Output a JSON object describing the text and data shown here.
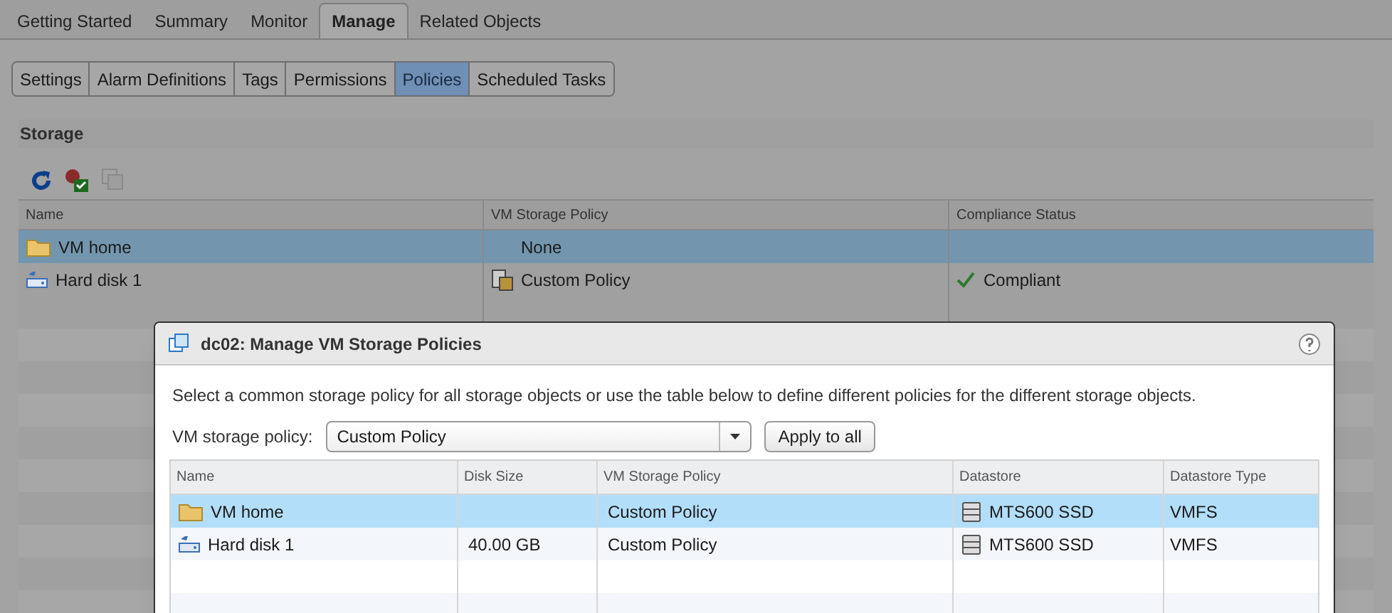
{
  "main_tabs": [
    {
      "label": "Getting Started",
      "selected": false
    },
    {
      "label": "Summary",
      "selected": false
    },
    {
      "label": "Monitor",
      "selected": false
    },
    {
      "label": "Manage",
      "selected": true
    },
    {
      "label": "Related Objects",
      "selected": false
    }
  ],
  "sub_tabs": [
    {
      "label": "Settings",
      "selected": false
    },
    {
      "label": "Alarm Definitions",
      "selected": false
    },
    {
      "label": "Tags",
      "selected": false
    },
    {
      "label": "Permissions",
      "selected": false
    },
    {
      "label": "Policies",
      "selected": true
    },
    {
      "label": "Scheduled Tasks",
      "selected": false
    }
  ],
  "section_title": "Storage",
  "toolbar": [
    {
      "kind": "refresh",
      "disabled": false
    },
    {
      "kind": "check-compliance",
      "disabled": false
    },
    {
      "kind": "reapply",
      "disabled": true
    }
  ],
  "storage_table": {
    "columns": [
      "Name",
      "VM Storage Policy",
      "Compliance Status"
    ],
    "rows": [
      {
        "kind": "folder",
        "name": "VM home",
        "policy": "None",
        "policy_icon": false,
        "compliance": "",
        "selected": true
      },
      {
        "kind": "disk",
        "name": "Hard disk 1",
        "policy": "Custom Policy",
        "policy_icon": true,
        "compliance": "Compliant",
        "selected": false
      }
    ]
  },
  "dialog": {
    "title": "dc02: Manage VM Storage Policies",
    "description": "Select a common storage policy for all storage objects or use the table below to define different policies for the different storage objects.",
    "policy_label": "VM storage policy:",
    "policy_value": "Custom Policy",
    "apply_button": "Apply to all",
    "table": {
      "columns": [
        "Name",
        "Disk Size",
        "VM Storage Policy",
        "Datastore",
        "Datastore Type"
      ],
      "rows": [
        {
          "kind": "folder",
          "name": "VM home",
          "disk_size": "",
          "policy": "Custom Policy",
          "datastore": "MTS600 SSD",
          "datastore_type": "VMFS",
          "selected": true
        },
        {
          "kind": "disk",
          "name": "Hard disk 1",
          "disk_size": "40.00 GB",
          "policy": "Custom Policy",
          "datastore": "MTS600 SSD",
          "datastore_type": "VMFS",
          "selected": false
        }
      ]
    }
  }
}
